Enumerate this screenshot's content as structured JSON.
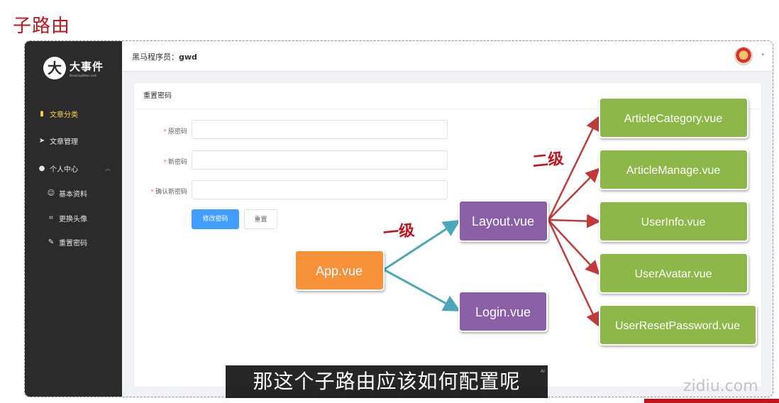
{
  "slide": {
    "title": "子路由"
  },
  "sidebar": {
    "logo_mark": "大",
    "logo_name": "大事件",
    "logo_sub": "BreakingNews.com",
    "items": [
      {
        "label": "文章分类",
        "icon": "bar-chart-icon",
        "glyph": "▮",
        "active": true
      },
      {
        "label": "文章管理",
        "icon": "paper-plane-icon",
        "glyph": "➤"
      },
      {
        "label": "个人中心",
        "icon": "user-icon",
        "glyph": "●",
        "arrow": "︿"
      },
      {
        "label": "基本资料",
        "icon": "user-outline-icon",
        "glyph": "☺"
      },
      {
        "label": "更换头像",
        "icon": "crop-icon",
        "glyph": "⌗"
      },
      {
        "label": "重置密码",
        "icon": "edit-pen-icon",
        "glyph": "✎"
      }
    ]
  },
  "topbar": {
    "welcome_prefix": "黑马程序员：",
    "username": "gwd",
    "caret": "▾"
  },
  "card": {
    "title": "重置密码",
    "fields": [
      {
        "label": "原密码",
        "required_mark": "*",
        "value": ""
      },
      {
        "label": "新密码",
        "required_mark": "*",
        "value": ""
      },
      {
        "label": "确认新密码",
        "required_mark": "*",
        "value": ""
      }
    ],
    "submit_label": "修改密码",
    "reset_label": "重置"
  },
  "diagram": {
    "root": "App.vue",
    "level1_label": "一级",
    "level2_label": "二级",
    "level1": [
      "Layout.vue",
      "Login.vue"
    ],
    "level2": [
      "ArticleCategory.vue",
      "ArticleManage.vue",
      "UserInfo.vue",
      "UserAvatar.vue",
      "UserResetPassword.vue"
    ],
    "colors": {
      "root": "#f7923b",
      "level1": "#8a5fa6",
      "level2": "#8db84a",
      "arrow_level1": "#4aa8b8",
      "arrow_level2": "#c0393b"
    }
  },
  "caption": {
    "text": "那这个子路由应该如何配置呢",
    "ai_mark": "AI"
  },
  "watermark": "zidiu.com"
}
